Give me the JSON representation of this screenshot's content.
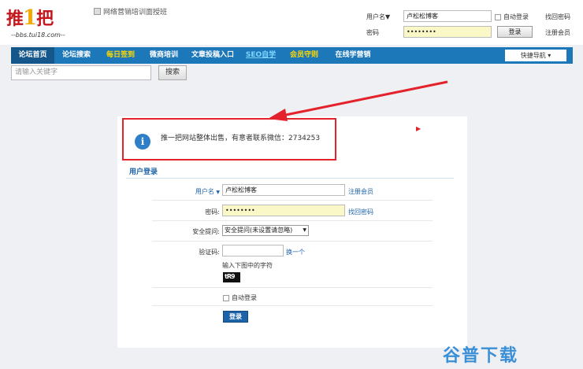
{
  "header": {
    "logo_text_a": "推",
    "logo_text_b": "1",
    "logo_text_c": "把",
    "logo_domain": "bbs.tui18.com",
    "banner_alt": "网络营销培训面授班",
    "username_label": "用户名",
    "username_value": "卢松松博客",
    "password_label": "密码",
    "password_value": "••••••••",
    "auto_login": "自动登录",
    "forgot_password": "找回密码",
    "login_button": "登录",
    "register": "注册会员"
  },
  "nav": {
    "items": [
      {
        "label": "论坛首页"
      },
      {
        "label": "论坛搜索"
      },
      {
        "label": "每日签到"
      },
      {
        "label": "微商培训"
      },
      {
        "label": "文章投稿入口"
      },
      {
        "label": "SEO自学"
      },
      {
        "label": "会员守则"
      },
      {
        "label": "在线学营销"
      }
    ],
    "quick_nav": "快捷导航"
  },
  "search": {
    "placeholder": "请输入关键字",
    "button": "搜索"
  },
  "notice": {
    "text": "推一把网站整体出售，有意者联系微信：2734253"
  },
  "login_form": {
    "title": "用户登录",
    "username_label": "用户名",
    "username_value": "卢松松博客",
    "register_link": "注册会员",
    "password_label": "密码:",
    "password_value": "••••••••",
    "forgot_link": "找回密码",
    "question_label": "安全提问:",
    "question_value": "安全提问(未设置请忽略)",
    "captcha_label": "验证码:",
    "captcha_refresh": "换一个",
    "captcha_hint": "输入下图中的字符",
    "captcha_text": "tR9",
    "auto_login": "自动登录",
    "submit": "登录"
  },
  "watermark": "谷普下载",
  "colors": {
    "nav_bg": "#1d78b9",
    "accent_red": "#e3222b",
    "link_blue": "#1d63a8"
  }
}
